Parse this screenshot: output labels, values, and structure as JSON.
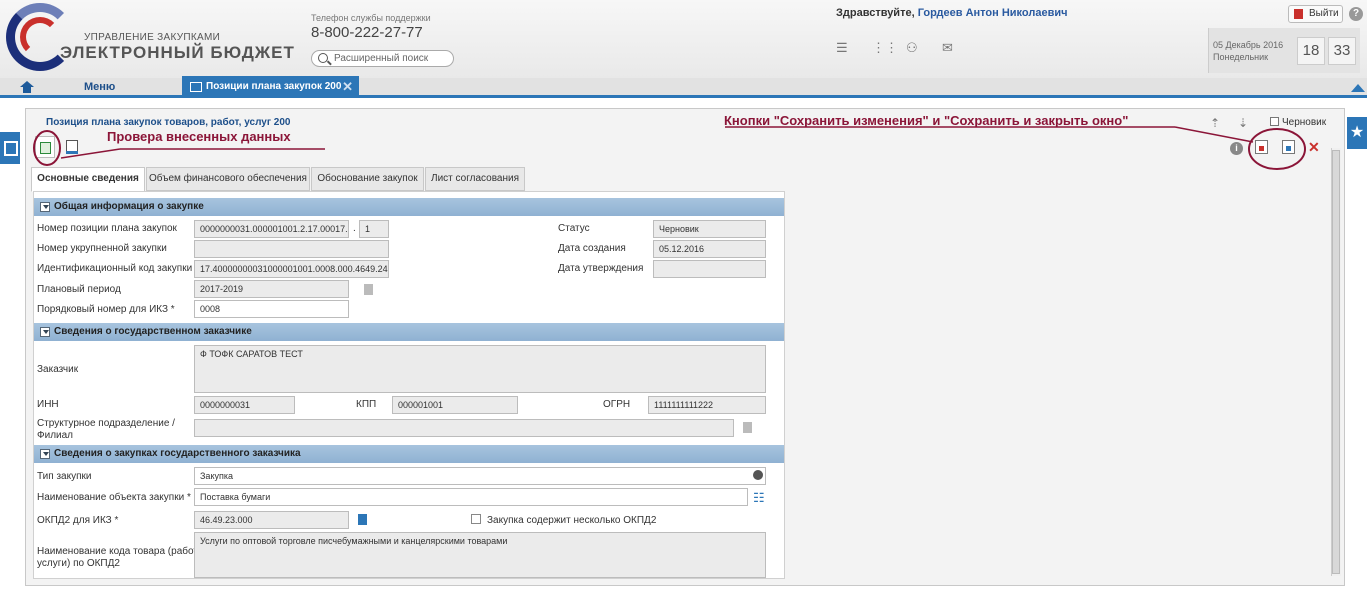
{
  "header": {
    "logo_line1": "УПРАВЛЕНИЕ ЗАКУПКАМИ",
    "logo_line2": "ЭЛЕКТРОННЫЙ БЮДЖЕТ",
    "support_label": "Телефон службы поддержки",
    "support_phone": "8-800-222-27-77",
    "search_placeholder": "Расширенный поиск",
    "greeting": "Здравствуйте,",
    "user_name": "Гордеев Антон Николаевич",
    "exit_label": "Выйти",
    "help": "?",
    "date": "05 Декабрь 2016",
    "weekday": "Понедельник",
    "hour": "18",
    "minute": "33"
  },
  "nav": {
    "menu_label": "Меню",
    "active_tab": "Позиции плана закупок 200"
  },
  "panel": {
    "title": "Позиция плана закупок товаров, работ, услуг 200",
    "draft_label": "Черновик",
    "annotation_left": "Провера внесенных данных",
    "annotation_right": "Кнопки \"Сохранить изменения\" и \"Сохранить и закрыть окно\"",
    "info": "i",
    "close": "✕"
  },
  "tabs": [
    "Основные сведения",
    "Объем финансового обеспечения",
    "Обоснование закупок",
    "Лист согласования"
  ],
  "sections": {
    "general": {
      "title": "Общая информация о закупке",
      "position_no_label": "Номер позиции плана закупок",
      "position_no_value": "0000000031.000001001.2.17.00017.",
      "position_no_sep": ".",
      "position_no_suffix": "1",
      "status_label": "Статус",
      "status_value": "Черновик",
      "consolidated_label": "Номер укрупненной закупки",
      "consolidated_value": "",
      "created_label": "Дата создания",
      "created_value": "05.12.2016",
      "ikz_label": "Идентификационный код закупки",
      "ikz_value": "17.40000000031000001001.0008.000.4649.24-",
      "approved_label": "Дата утверждения",
      "approved_value": "",
      "period_label": "Плановый период",
      "period_value": "2017-2019",
      "seq_label": "Порядковый номер для ИКЗ *",
      "seq_value": "0008"
    },
    "customer": {
      "title": "Сведения о государственном заказчике",
      "customer_label": "Заказчик",
      "customer_value": "Ф ТОФК САРАТОВ ТЕСТ",
      "inn_label": "ИНН",
      "inn_value": "0000000031",
      "kpp_label": "КПП",
      "kpp_value": "000001001",
      "ogrn_label": "ОГРН",
      "ogrn_value": "1111111111222",
      "branch_label_1": "Структурное подразделение /",
      "branch_label_2": "Филиал",
      "branch_value": ""
    },
    "purchases": {
      "title": "Сведения о закупках государственного заказчика",
      "type_label": "Тип закупки",
      "type_value": "Закупка",
      "object_label": "Наименование объекта закупки *",
      "object_value": "Поставка бумаги",
      "okpd_label": "ОКПД2 для ИКЗ *",
      "okpd_value": "46.49.23.000",
      "multi_okpd_label": "Закупка содержит несколько ОКПД2",
      "okpd_name_label_1": "Наименование кода товара (работы,",
      "okpd_name_label_2": "услуги) по ОКПД2",
      "okpd_name_value": "Услуги по оптовой торговле писчебумажными и канцелярскими товарами"
    }
  }
}
